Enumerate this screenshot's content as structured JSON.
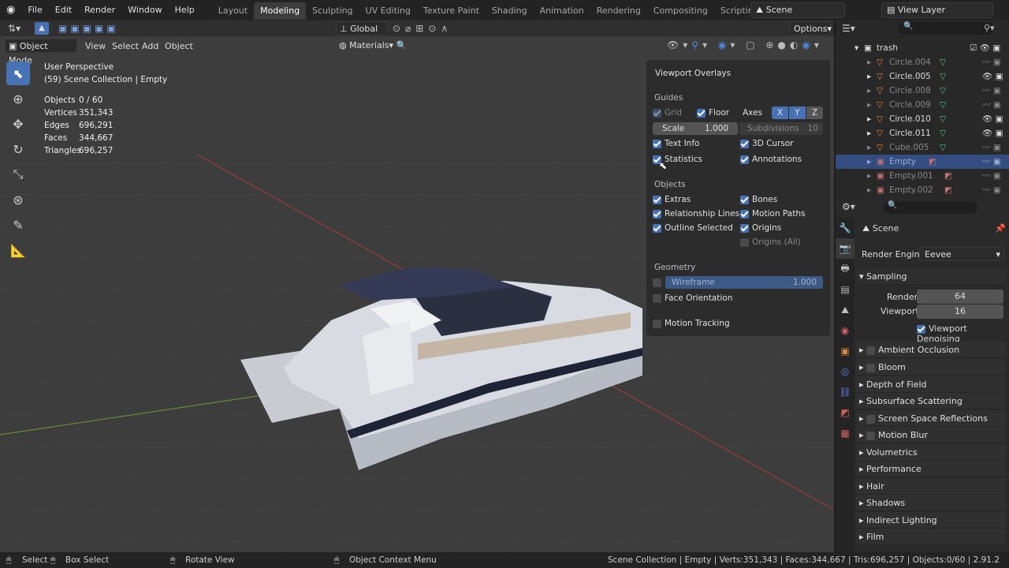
{
  "topbar": {
    "menus": [
      "File",
      "Edit",
      "Render",
      "Window",
      "Help"
    ],
    "workspaces": [
      "Layout",
      "Modeling",
      "Sculpting",
      "UV Editing",
      "Texture Paint",
      "Shading",
      "Animation",
      "Rendering",
      "Compositing",
      "Scripting"
    ],
    "active_workspace": "Modeling",
    "add_workspace": "+",
    "scene": "Scene",
    "view_layer": "View Layer"
  },
  "header": {
    "orientation": "Global",
    "options": "Options",
    "mode": "Object Mode",
    "menus": [
      "View",
      "Select",
      "Add",
      "Object"
    ],
    "materials": "Materials"
  },
  "viewport": {
    "perspective": "User Perspective",
    "collection": "(59) Scene Collection | Empty",
    "stats": [
      {
        "label": "Objects",
        "value": "0 / 60"
      },
      {
        "label": "Vertices",
        "value": "351,343"
      },
      {
        "label": "Edges",
        "value": "696,291"
      },
      {
        "label": "Faces",
        "value": "344,667"
      },
      {
        "label": "Triangles",
        "value": "696,257"
      }
    ]
  },
  "overlay": {
    "title": "Viewport Overlays",
    "guides": "Guides",
    "grid": "Grid",
    "floor": "Floor",
    "axes": "Axes",
    "x": "X",
    "y": "Y",
    "z": "Z",
    "scale": "Scale",
    "scale_val": "1.000",
    "subdivisions": "Subdivisions",
    "subdiv_val": "10",
    "text_info": "Text Info",
    "cursor": "3D Cursor",
    "statistics": "Statistics",
    "annotations": "Annotations",
    "objects": "Objects",
    "extras": "Extras",
    "bones": "Bones",
    "relationship": "Relationship Lines",
    "motion_paths": "Motion Paths",
    "outline": "Outline Selected",
    "origins": "Origins",
    "origins_all": "Origins (All)",
    "geometry": "Geometry",
    "wireframe": "Wireframe",
    "wire_val": "1.000",
    "face_orient": "Face Orientation",
    "motion_tracking": "Motion Tracking"
  },
  "outliner": {
    "items": [
      "trash",
      "Circle.004",
      "Circle.005",
      "Circle.008",
      "Circle.009",
      "Circle.010",
      "Circle.011",
      "Cube.005",
      "Empty",
      "Empty.001",
      "Empty.002"
    ]
  },
  "props": {
    "scene": "Scene",
    "render_engine_label": "Render Engine",
    "render_engine": "Eevee",
    "sampling": "Sampling",
    "render": "Render",
    "render_val": "64",
    "viewport": "Viewport",
    "viewport_val": "16",
    "denoise": "Viewport Denoising",
    "sections": [
      "Ambient Occlusion",
      "Bloom",
      "Depth of Field",
      "Subsurface Scattering",
      "Screen Space Reflections",
      "Motion Blur",
      "Volumetrics",
      "Performance",
      "Hair",
      "Shadows",
      "Indirect Lighting",
      "Film"
    ]
  },
  "status": {
    "select": "Select",
    "box_select": "Box Select",
    "rotate": "Rotate View",
    "context": "Object Context Menu",
    "info": "Scene Collection | Empty | Verts:351,343 | Faces:344,667 | Tris:696,257 | Objects:0/60 | 2.91.2"
  }
}
